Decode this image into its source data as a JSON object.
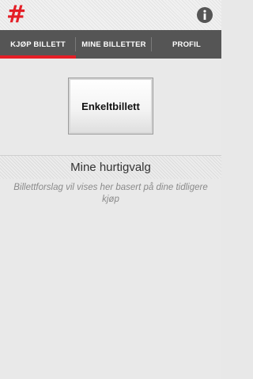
{
  "app": {
    "logo_glyph": "#",
    "brand_color": "#e41e26"
  },
  "tabs": [
    {
      "label": "KJØP BILLETT",
      "selected": true
    },
    {
      "label": "MINE BILLETTER",
      "selected": false
    },
    {
      "label": "PROFIL",
      "selected": false
    }
  ],
  "main": {
    "single_ticket_label": "Enkeltbillett",
    "quick_choices_title": "Mine hurtigvalg",
    "quick_choices_hint": "Billettforslag vil vises her basert på dine tidligere kjøp"
  },
  "icons": {
    "logo": "hash-logo-icon",
    "info": "info-icon"
  }
}
